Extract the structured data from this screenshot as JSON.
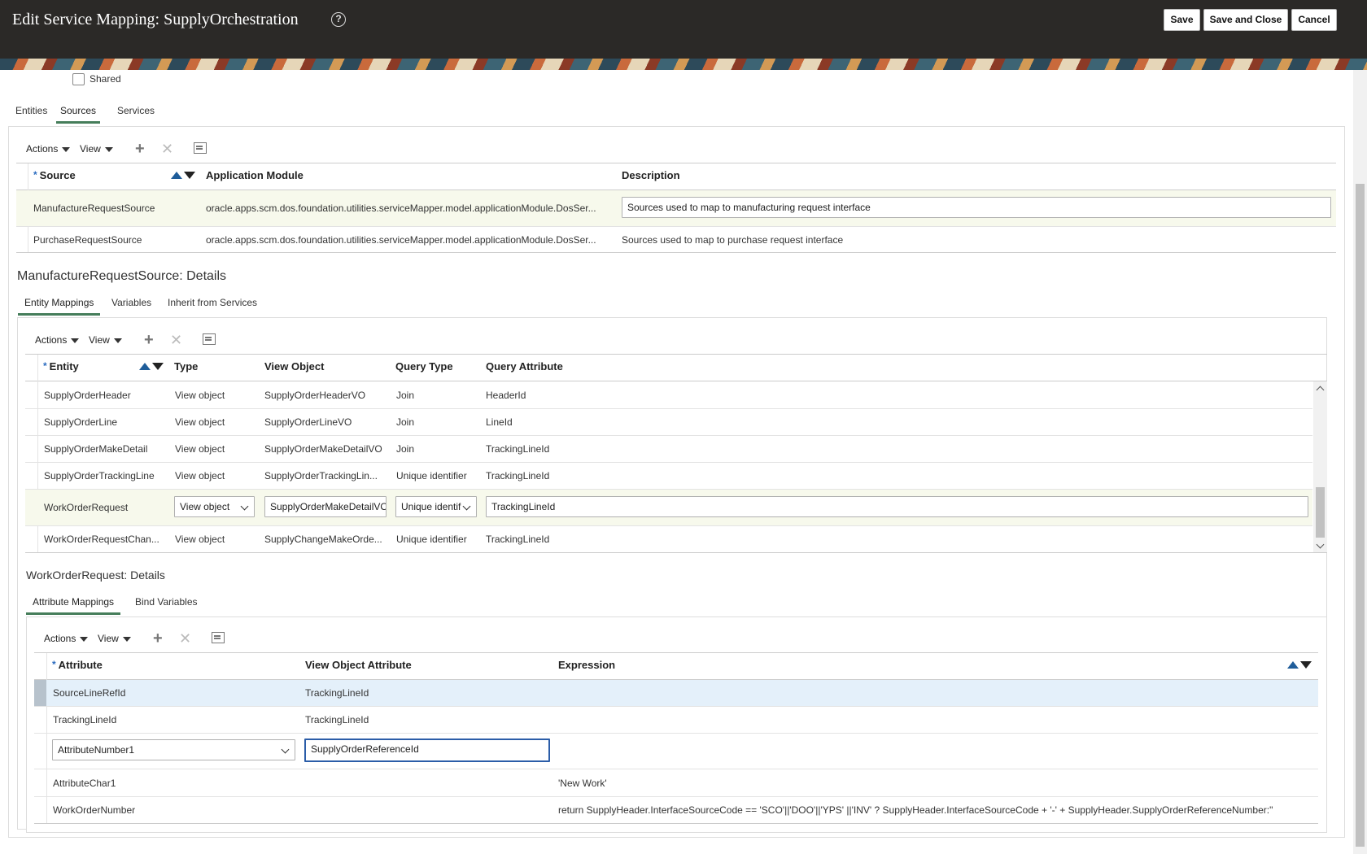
{
  "header": {
    "title": "Edit Service Mapping: SupplyOrchestration",
    "help_icon": "?",
    "save": "Save",
    "save_close": "Save and Close",
    "cancel": "Cancel"
  },
  "shared_label": "Shared",
  "tabs": [
    "Entities",
    "Sources",
    "Services"
  ],
  "toolbar": {
    "actions": "Actions",
    "view": "View"
  },
  "sources_table": {
    "headers": {
      "source": "Source",
      "module": "Application Module",
      "description": "Description"
    },
    "rows": [
      {
        "source": "ManufactureRequestSource",
        "module": "oracle.apps.scm.dos.foundation.utilities.serviceMapper.model.applicationModule.DosSer...",
        "description": "Sources used to map to manufacturing request interface"
      },
      {
        "source": "PurchaseRequestSource",
        "module": "oracle.apps.scm.dos.foundation.utilities.serviceMapper.model.applicationModule.DosSer...",
        "description": "Sources used to map to purchase request interface"
      }
    ]
  },
  "source_details": {
    "title": "ManufactureRequestSource: Details",
    "tabs": [
      "Entity Mappings",
      "Variables",
      "Inherit from Services"
    ]
  },
  "entity_table": {
    "headers": {
      "entity": "Entity",
      "type": "Type",
      "view_object": "View Object",
      "query_type": "Query Type",
      "query_attribute": "Query Attribute"
    },
    "rows": [
      {
        "entity": "SupplyOrderHeader",
        "type": "View object",
        "view_object": "SupplyOrderHeaderVO",
        "query_type": "Join",
        "query_attribute": "HeaderId"
      },
      {
        "entity": "SupplyOrderLine",
        "type": "View object",
        "view_object": "SupplyOrderLineVO",
        "query_type": "Join",
        "query_attribute": "LineId"
      },
      {
        "entity": "SupplyOrderMakeDetail",
        "type": "View object",
        "view_object": "SupplyOrderMakeDetailVO",
        "query_type": "Join",
        "query_attribute": "TrackingLineId"
      },
      {
        "entity": "SupplyOrderTrackingLine",
        "type": "View object",
        "view_object": "SupplyOrderTrackingLin...",
        "query_type": "Unique identifier",
        "query_attribute": "TrackingLineId"
      },
      {
        "entity": "WorkOrderRequest",
        "type": "View object",
        "view_object": "SupplyOrderMakeDetailVO",
        "query_type": "Unique identif",
        "query_attribute": "TrackingLineId"
      },
      {
        "entity": "WorkOrderRequestChan...",
        "type": "View object",
        "view_object": "SupplyChangeMakeOrde...",
        "query_type": "Unique identifier",
        "query_attribute": "TrackingLineId"
      }
    ]
  },
  "entity_details": {
    "title": "WorkOrderRequest: Details",
    "tabs": [
      "Attribute Mappings",
      "Bind Variables"
    ]
  },
  "attribute_table": {
    "headers": {
      "attribute": "Attribute",
      "vo_attribute": "View Object Attribute",
      "expression": "Expression"
    },
    "rows": [
      {
        "attribute": "SourceLineRefId",
        "vo_attribute": "TrackingLineId",
        "expression": ""
      },
      {
        "attribute": "TrackingLineId",
        "vo_attribute": "TrackingLineId",
        "expression": ""
      },
      {
        "attribute": "AttributeNumber1",
        "vo_attribute": "SupplyOrderReferenceId",
        "expression": ""
      },
      {
        "attribute": "AttributeChar1",
        "vo_attribute": "",
        "expression": "'New Work'"
      },
      {
        "attribute": "WorkOrderNumber",
        "vo_attribute": "",
        "expression": "return SupplyHeader.InterfaceSourceCode == 'SCO'||'DOO'||'YPS' ||'INV' ? SupplyHeader.InterfaceSourceCode + '-' + SupplyHeader.SupplyOrderReferenceNumber:\""
      }
    ]
  }
}
